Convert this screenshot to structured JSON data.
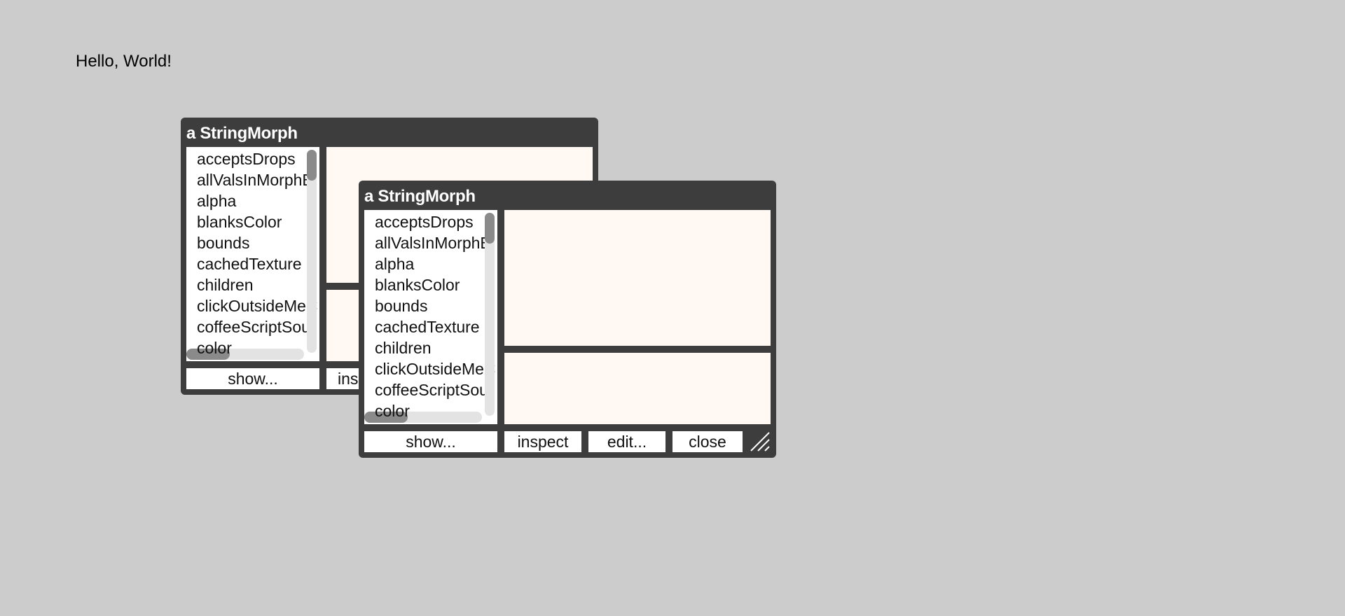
{
  "world": {
    "hello_text": "Hello, World!"
  },
  "inspectors": [
    {
      "title": "a StringMorph",
      "items": [
        "acceptsDrops",
        "allValsInMorphB",
        "alpha",
        "blanksColor",
        "bounds",
        "cachedTexture",
        "children",
        "clickOutsideMeC",
        "coffeeScriptSour",
        "color"
      ],
      "buttons": {
        "show": "show...",
        "inspect": "ins"
      }
    },
    {
      "title": "a StringMorph",
      "items": [
        "acceptsDrops",
        "allValsInMorphB",
        "alpha",
        "blanksColor",
        "bounds",
        "cachedTexture",
        "children",
        "clickOutsideMeC",
        "coffeeScriptSour",
        "color"
      ],
      "buttons": {
        "show": "show...",
        "inspect": "inspect",
        "edit": "edit...",
        "close": "close"
      }
    }
  ],
  "colors": {
    "background": "#cccccc",
    "window": "#3d3d3d",
    "pane": "#fff8f3",
    "scroll_thumb": "#8a8a8a"
  }
}
